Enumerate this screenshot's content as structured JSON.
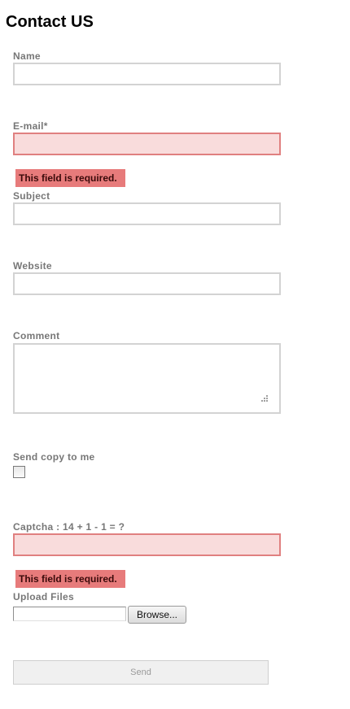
{
  "page": {
    "title": "Contact US"
  },
  "form": {
    "name": {
      "label": "Name",
      "value": ""
    },
    "email": {
      "label": "E-mail*",
      "value": "",
      "error": "This field is required."
    },
    "subject": {
      "label": "Subject",
      "value": ""
    },
    "website": {
      "label": "Website",
      "value": ""
    },
    "comment": {
      "label": "Comment",
      "value": ""
    },
    "send_copy": {
      "label": "Send copy to me",
      "checked": false
    },
    "captcha": {
      "label": "Captcha : 14 + 1  - 1 = ?",
      "value": "",
      "error": "This field is required."
    },
    "upload": {
      "label": "Upload Files",
      "browse_label": "Browse..."
    },
    "send_label": "Send"
  },
  "colors": {
    "error_border": "#e08080",
    "error_background": "#f9dcdc",
    "error_message_background": "#e77b7b",
    "label_text": "#777777"
  },
  "icons": {
    "resize_grip": "resize-grip-icon"
  }
}
